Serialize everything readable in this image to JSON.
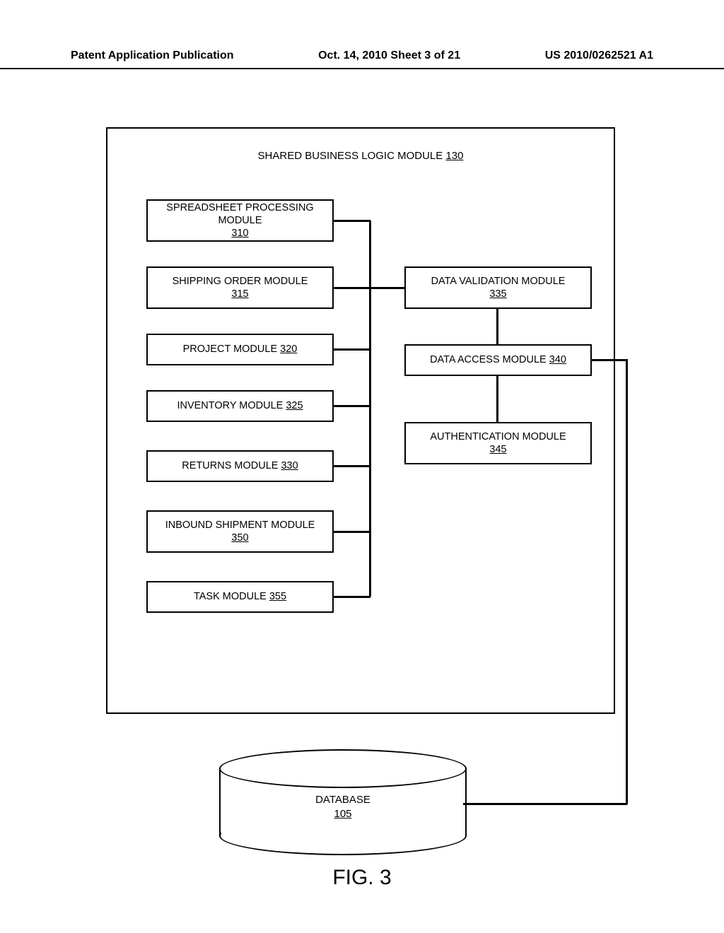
{
  "header": {
    "left": "Patent Application Publication",
    "mid": "Oct. 14, 2010   Sheet 3 of 21",
    "right": "US 2010/0262521 A1"
  },
  "container": {
    "title": "SHARED BUSINESS LOGIC MODULE",
    "ref": "130"
  },
  "modules": {
    "m310": {
      "label": "SPREADSHEET PROCESSING MODULE",
      "ref": "310"
    },
    "m315": {
      "label": "SHIPPING ORDER MODULE",
      "ref": "315"
    },
    "m320": {
      "label": "PROJECT MODULE",
      "ref": "320"
    },
    "m325": {
      "label": "INVENTORY MODULE",
      "ref": "325"
    },
    "m330": {
      "label": "RETURNS MODULE",
      "ref": "330"
    },
    "m350": {
      "label": "INBOUND SHIPMENT MODULE",
      "ref": "350"
    },
    "m355": {
      "label": "TASK MODULE",
      "ref": "355"
    },
    "m335": {
      "label": "DATA VALIDATION MODULE",
      "ref": "335"
    },
    "m340": {
      "label": "DATA ACCESS MODULE",
      "ref": "340"
    },
    "m345": {
      "label": "AUTHENTICATION MODULE",
      "ref": "345"
    }
  },
  "database": {
    "label": "DATABASE",
    "ref": "105"
  },
  "figure": "FIG. 3"
}
